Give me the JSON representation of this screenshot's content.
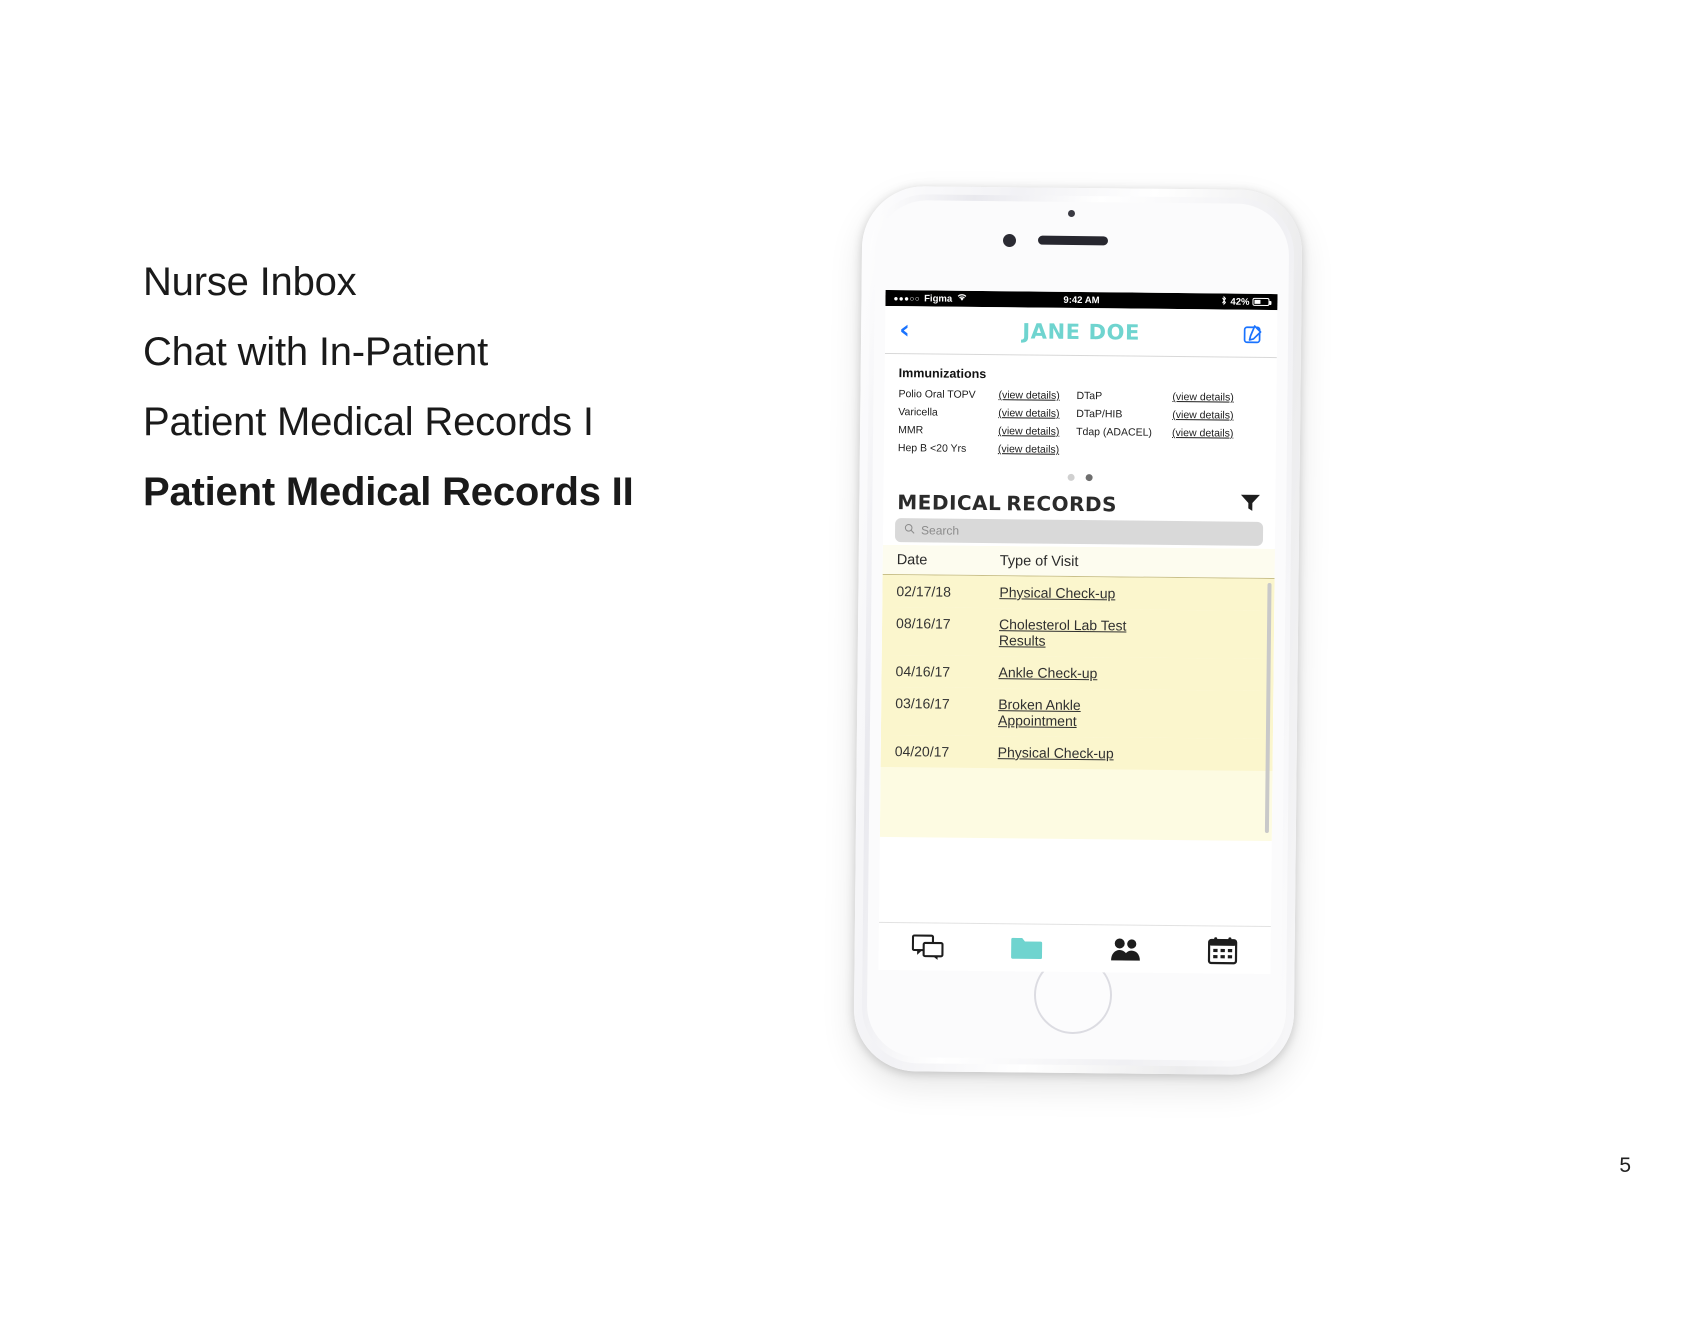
{
  "slide": {
    "bullets": [
      {
        "label": "Nurse Inbox",
        "bold": false
      },
      {
        "label": "Chat with In-Patient",
        "bold": false
      },
      {
        "label": "Patient Medical Records I",
        "bold": false
      },
      {
        "label": "Patient Medical Records II",
        "bold": true
      }
    ],
    "page_number": "5"
  },
  "phone": {
    "status_bar": {
      "signal_dots": "●●●○○",
      "carrier": "Figma",
      "wifi_icon": "wifi-icon",
      "time": "9:42 AM",
      "bluetooth_icon": "bluetooth-icon",
      "battery_text": "42%",
      "battery_level": 42
    },
    "navbar": {
      "back_icon": "chevron-left-icon",
      "title": "JANE DOE",
      "edit_icon": "compose-icon",
      "title_color": "#6fd4cf",
      "action_color": "#1a73ff"
    },
    "immunizations": {
      "title": "Immunizations",
      "view_details_label": "(view details)",
      "left_column": [
        "Polio Oral TOPV",
        "Varicella",
        "MMR",
        "Hep B <20 Yrs"
      ],
      "right_column": [
        "DTaP",
        "DTaP/HIB",
        "Tdap (ADACEL)",
        ""
      ]
    },
    "pager": {
      "count": 2,
      "active_index": 1
    },
    "medical_records": {
      "title_part1": "MEDICAL",
      "title_part2": "RECORDS",
      "filter_icon": "filter-icon",
      "search": {
        "icon": "search-icon",
        "placeholder": "Search",
        "value": ""
      },
      "columns": [
        "Date",
        "Type of Visit"
      ],
      "rows": [
        {
          "date": "02/17/18",
          "type_line1": "Physical Check-up",
          "type_line2": ""
        },
        {
          "date": "08/16/17",
          "type_line1": "Cholesterol Lab Test",
          "type_line2": "Results"
        },
        {
          "date": "04/16/17",
          "type_line1": "Ankle Check-up",
          "type_line2": ""
        },
        {
          "date": "03/16/17",
          "type_line1": "Broken Ankle",
          "type_line2": "Appointment"
        },
        {
          "date": "04/20/17",
          "type_line1": "Physical Check-up",
          "type_line2": ""
        }
      ],
      "row_bg": "#fbf6cd",
      "header_bg": "#fdfcef"
    },
    "tabbar": {
      "items": [
        {
          "icon": "chat-bubbles-icon",
          "active": false
        },
        {
          "icon": "folder-icon",
          "active": true
        },
        {
          "icon": "people-icon",
          "active": false
        },
        {
          "icon": "calendar-icon",
          "active": false
        }
      ],
      "active_color": "#6fd4cf"
    }
  }
}
